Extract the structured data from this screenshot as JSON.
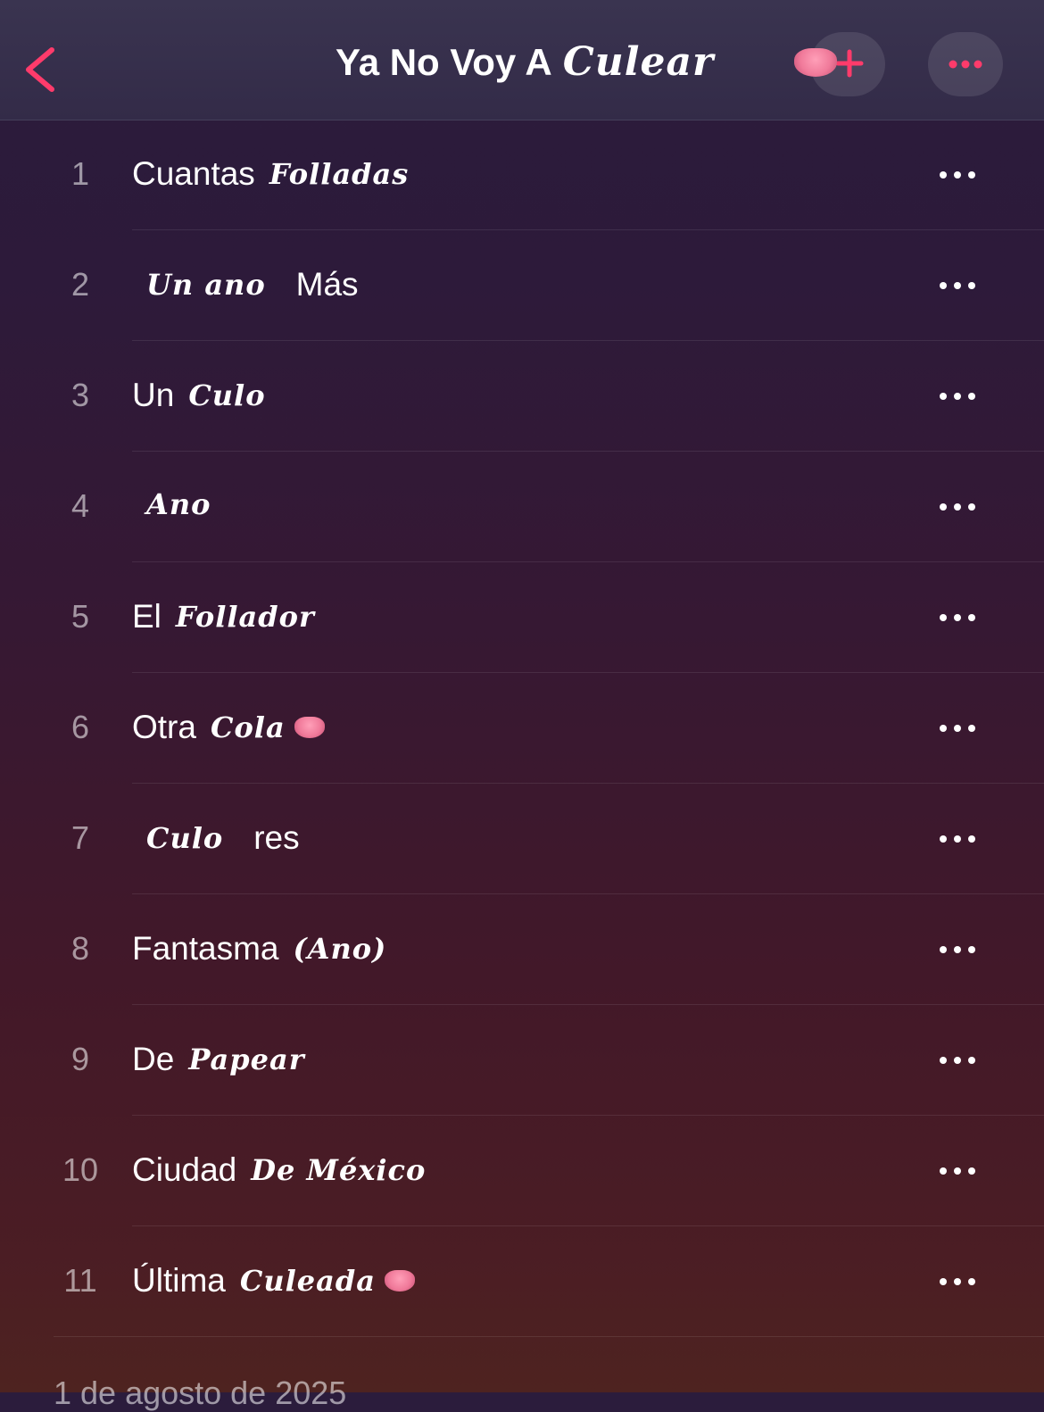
{
  "header": {
    "title_plain": "Ya No Voy A",
    "title_script": "Culear",
    "back_label": "Back",
    "accent_color": "#ff3b6b"
  },
  "tracks": [
    {
      "number": "1",
      "parts": [
        {
          "style": "plain",
          "text": "Cuantas"
        },
        {
          "style": "script",
          "text": "Folladas"
        }
      ]
    },
    {
      "number": "2",
      "parts": [
        {
          "style": "script",
          "text": "Un ano"
        },
        {
          "style": "plain",
          "text": "Más"
        }
      ]
    },
    {
      "number": "3",
      "parts": [
        {
          "style": "plain",
          "text": "Un"
        },
        {
          "style": "script",
          "text": "Culo"
        }
      ]
    },
    {
      "number": "4",
      "parts": [
        {
          "style": "script",
          "text": "Ano"
        }
      ]
    },
    {
      "number": "5",
      "parts": [
        {
          "style": "plain",
          "text": "El"
        },
        {
          "style": "script",
          "text": "Follador"
        }
      ]
    },
    {
      "number": "6",
      "parts": [
        {
          "style": "plain",
          "text": "Otra"
        },
        {
          "style": "script",
          "text": "Cola"
        }
      ],
      "emoji": true
    },
    {
      "number": "7",
      "parts": [
        {
          "style": "script",
          "text": "Culo"
        },
        {
          "style": "plain",
          "text": "res"
        }
      ]
    },
    {
      "number": "8",
      "parts": [
        {
          "style": "plain",
          "text": "Fantasma"
        },
        {
          "style": "script",
          "text": "(Ano)"
        }
      ]
    },
    {
      "number": "9",
      "parts": [
        {
          "style": "plain",
          "text": "De"
        },
        {
          "style": "script",
          "text": "Papear"
        }
      ]
    },
    {
      "number": "10",
      "parts": [
        {
          "style": "plain",
          "text": "Ciudad"
        },
        {
          "style": "script",
          "text": "De México"
        }
      ]
    },
    {
      "number": "11",
      "parts": [
        {
          "style": "plain",
          "text": "Última"
        },
        {
          "style": "script",
          "text": "Culeada"
        }
      ],
      "emoji": true
    }
  ],
  "footer": {
    "release_date": "1 de agosto de 2025"
  }
}
